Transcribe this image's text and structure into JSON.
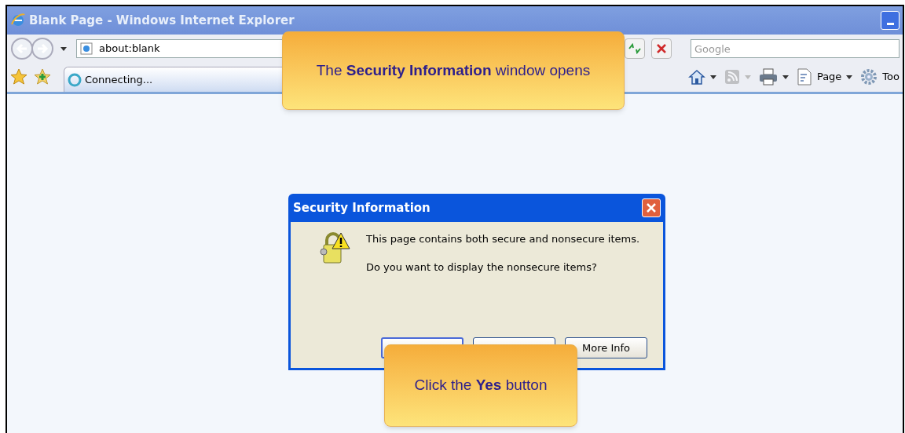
{
  "window": {
    "title": "Blank Page - Windows Internet Explorer"
  },
  "address_bar": {
    "value": "about:blank"
  },
  "search": {
    "placeholder": "Google"
  },
  "tab": {
    "label": "Connecting...",
    "loading": true
  },
  "command_bar": [
    {
      "kind": "home",
      "disabled": false
    },
    {
      "kind": "feeds",
      "disabled": true
    },
    {
      "kind": "print",
      "disabled": false
    },
    {
      "kind": "page",
      "label": "Page",
      "disabled": false
    },
    {
      "kind": "tools",
      "label": "Too",
      "disabled": false
    }
  ],
  "dialog": {
    "title": "Security Information",
    "message": "This page contains both secure and nonsecure items.",
    "question": "Do you want to display the nonsecure items?",
    "buttons": [
      {
        "focused": true
      },
      {
        "focused": false
      },
      {
        "label": "More Info",
        "focused": false
      }
    ]
  },
  "callouts": [
    {
      "text": "The **Security Information** window opens"
    },
    {
      "text": "Click the **Yes** button"
    }
  ]
}
